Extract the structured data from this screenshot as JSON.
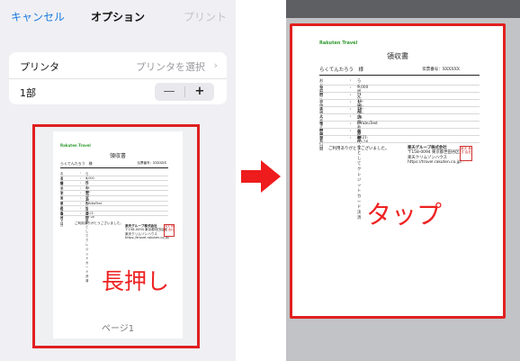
{
  "nav": {
    "cancel": "キャンセル",
    "title": "オプション",
    "print": "プリント"
  },
  "printer_row": {
    "label": "プリンタ",
    "value": "プリンタを選択",
    "chevron": "›"
  },
  "copies_row": {
    "label": "1部",
    "minus": "—",
    "plus": "+"
  },
  "preview": {
    "page_label": "ページ1"
  },
  "annotations": {
    "long_press": "長押し",
    "tap": "タップ",
    "arrow_color": "#ee1c1c",
    "frame_color": "#e02020"
  },
  "receipt": {
    "logo": "Rakuten Travel",
    "title": "領収書",
    "recipient": "らくてんたろう　様",
    "number": "伝票番号：XXXXXX",
    "rows": [
      {
        "key": "お名前",
        "value": "らくてんたろう"
      },
      {
        "key": "金額",
        "value": "9,000円"
      },
      {
        "key": "宿泊施設",
        "value": "ひとまち小丹小旅館"
      },
      {
        "key": "チェックイン日",
        "value": "19-08-28"
      },
      {
        "key": "チェックアウト日",
        "value": "19-08-29"
      },
      {
        "key": "人数",
        "value": "大人1名様"
      },
      {
        "key": "予約番号",
        "value": "RYubuTest"
      },
      {
        "key": "但し",
        "value": "宿泊代金としてクレジットカード決済"
      },
      {
        "key": "発行日",
        "value": "2021-03-26"
      }
    ],
    "separator": ":",
    "thanks": "ご利用ありがとうございました。",
    "company": [
      "楽天グループ株式会社",
      "〒158-0094 東京都世田谷区",
      "楽天クリムゾンハウス",
      "https://travel.rakuten.co.jp/"
    ],
    "stamp": "楽天 株式 会社"
  }
}
